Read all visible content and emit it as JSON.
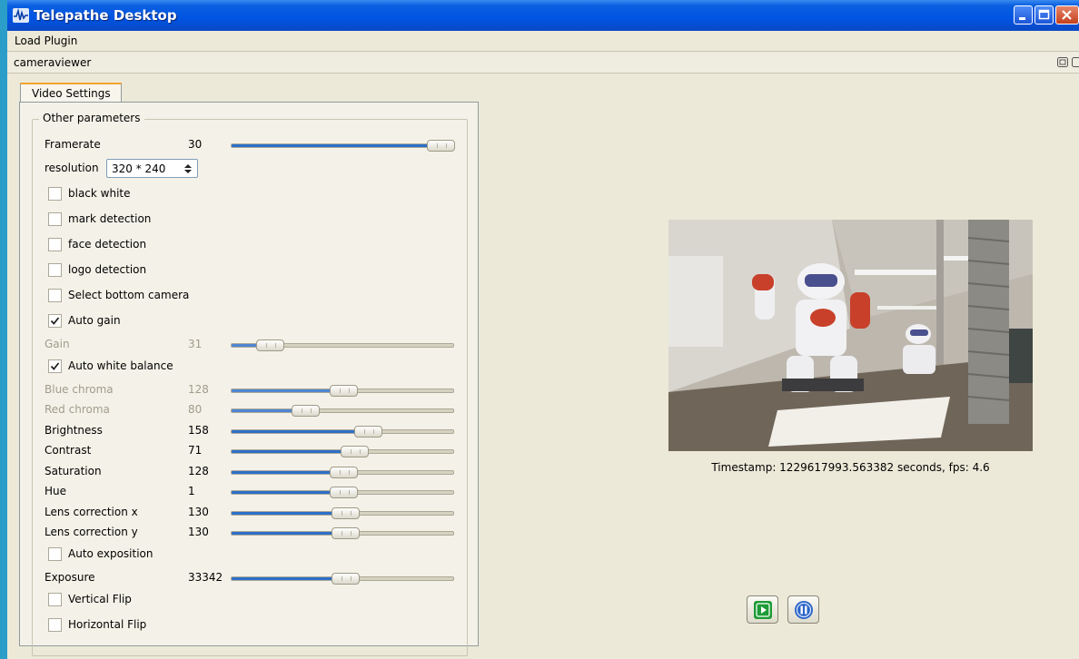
{
  "window": {
    "title": "Telepathe Desktop"
  },
  "menubar": {
    "load_plugin": "Load Plugin"
  },
  "dock": {
    "title": "cameraviewer"
  },
  "tab": {
    "label": "Video Settings"
  },
  "group": {
    "title": "Other parameters"
  },
  "framerate": {
    "label": "Framerate",
    "value": "30",
    "fraction": 0.94
  },
  "resolution": {
    "label": "resolution",
    "value": "320 * 240"
  },
  "checkboxes": {
    "black_white": {
      "label": "black  white",
      "checked": false
    },
    "mark_detection": {
      "label": "mark detection",
      "checked": false
    },
    "face_detection": {
      "label": "face detection",
      "checked": false
    },
    "logo_detection": {
      "label": "logo detection",
      "checked": false
    },
    "bottom_camera": {
      "label": "Select bottom camera",
      "checked": false
    },
    "auto_gain": {
      "label": "Auto gain",
      "checked": true
    },
    "auto_white_balance": {
      "label": "Auto white balance",
      "checked": true
    },
    "auto_exposition": {
      "label": "Auto exposition",
      "checked": false
    },
    "vertical_flip": {
      "label": "Vertical Flip",
      "checked": false
    },
    "horizontal_flip": {
      "label": "Horizontal Flip",
      "checked": false
    }
  },
  "sliders": {
    "gain": {
      "label": "Gain",
      "value": "31",
      "fraction": 0.17,
      "disabled": true
    },
    "blue_chroma": {
      "label": "Blue chroma",
      "value": "128",
      "fraction": 0.5,
      "disabled": true
    },
    "red_chroma": {
      "label": "Red chroma",
      "value": "80",
      "fraction": 0.33,
      "disabled": true
    },
    "brightness": {
      "label": "Brightness",
      "value": "158",
      "fraction": 0.61,
      "disabled": false
    },
    "contrast": {
      "label": "Contrast",
      "value": "71",
      "fraction": 0.55,
      "disabled": false
    },
    "saturation": {
      "label": "Saturation",
      "value": "128",
      "fraction": 0.5,
      "disabled": false
    },
    "hue": {
      "label": "Hue",
      "value": "1",
      "fraction": 0.5,
      "disabled": false
    },
    "lens_x": {
      "label": "Lens correction x",
      "value": "130",
      "fraction": 0.51,
      "disabled": false
    },
    "lens_y": {
      "label": "Lens correction y",
      "value": "130",
      "fraction": 0.51,
      "disabled": false
    },
    "exposure": {
      "label": "Exposure",
      "value": "33342",
      "fraction": 0.51,
      "disabled": false
    }
  },
  "camera": {
    "timestamp": "Timestamp: 1229617993.563382 seconds,  fps: 4.6"
  },
  "icons": {
    "app": "waveform-icon",
    "play": "play-icon",
    "pause": "pause-icon"
  },
  "colors": {
    "titlebar": "#0054e3",
    "accent": "#2c6fc7",
    "play_green": "#1e9a36",
    "pause_blue": "#2b64c9"
  }
}
